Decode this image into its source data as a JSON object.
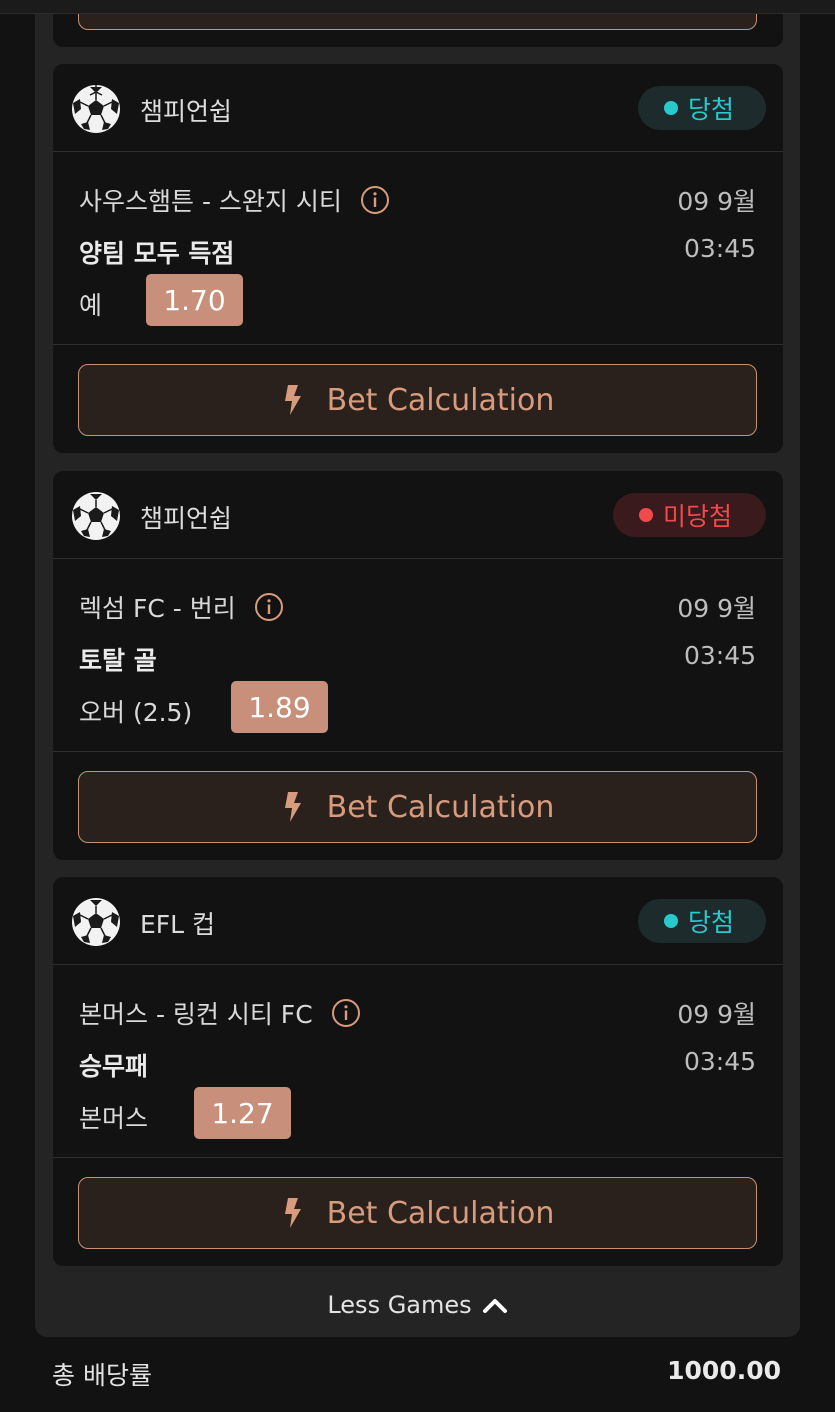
{
  "colors": {
    "background": "#121212",
    "panel": "#242424",
    "accent": "#c89272",
    "odds_bg": "#c8907a",
    "win": "#28c8cc",
    "lose": "#f04a4a"
  },
  "bets": [
    {
      "league": "챔피언쉽",
      "league_icon": "soccer-ball-icon",
      "status": "당첨",
      "status_type": "win",
      "match": "사우스햄튼 - 스완지 시티",
      "date": "09 9월",
      "market": "양팀 모두 득점",
      "time": "03:45",
      "pick": "예",
      "odds": "1.70",
      "action_label": "Bet Calculation"
    },
    {
      "league": "챔피언쉽",
      "league_icon": "soccer-ball-icon",
      "status": "미당첨",
      "status_type": "lose",
      "match": "렉섬 FC - 번리",
      "date": "09 9월",
      "market": "토탈 골",
      "time": "03:45",
      "pick": "오버 (2.5)",
      "odds": "1.89",
      "action_label": "Bet Calculation"
    },
    {
      "league": "EFL 컵",
      "league_icon": "soccer-ball-icon",
      "status": "당첨",
      "status_type": "win",
      "match": "본머스 - 링컨 시티 FC",
      "date": "09 9월",
      "market": "승무패",
      "time": "03:45",
      "pick": "본머스",
      "odds": "1.27",
      "action_label": "Bet Calculation"
    }
  ],
  "less_games_label": "Less Games",
  "total": {
    "label": "총 배당률",
    "value": "1000.00"
  }
}
